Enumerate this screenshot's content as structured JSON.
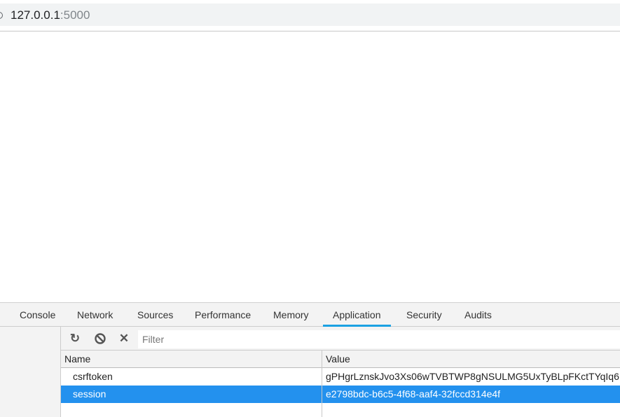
{
  "address_bar": {
    "host": "127.0.0.1",
    "port": ":5000"
  },
  "devtools": {
    "tabs": [
      {
        "label": "Console",
        "active": false
      },
      {
        "label": "Network",
        "active": false
      },
      {
        "label": "Sources",
        "active": false
      },
      {
        "label": "Performance",
        "active": false
      },
      {
        "label": "Memory",
        "active": false
      },
      {
        "label": "Application",
        "active": true
      },
      {
        "label": "Security",
        "active": false
      },
      {
        "label": "Audits",
        "active": false
      }
    ],
    "accent_color": "#1ba1e2",
    "toolbar": {
      "refresh_icon": "refresh-icon",
      "clear_all_icon": "block-icon",
      "delete_icon": "close-icon",
      "filter_placeholder": "Filter",
      "filter_value": ""
    },
    "cookies": {
      "columns": [
        "Name",
        "Value"
      ],
      "rows": [
        {
          "name": "csrftoken",
          "value": "gPHgrLznskJvo3Xs06wTVBTWP8gNSULMG5UxTyBLpFKctTYqIq6",
          "selected": false
        },
        {
          "name": "session",
          "value": "e2798bdc-b6c5-4f68-aaf4-32fccd314e4f",
          "selected": true
        }
      ],
      "selected_color": "#2391ee"
    }
  }
}
